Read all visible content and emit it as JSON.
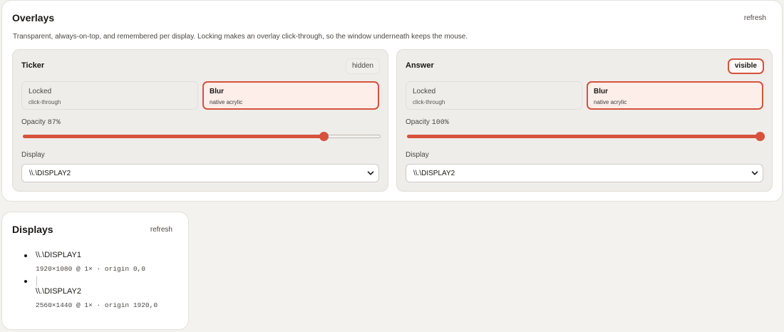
{
  "overlays": {
    "title": "Overlays",
    "refresh_label": "refresh",
    "description": "Transparent, always-on-top, and remembered per display. Locking makes an overlay click-through, so the window underneath keeps the mouse.",
    "panels": [
      {
        "name": "Ticker",
        "status": "hidden",
        "locked_label": "Locked",
        "locked_sub": "click-through",
        "blur_label": "Blur",
        "blur_sub": "native acrylic",
        "blur_selected": true,
        "opacity_label": "Opacity",
        "opacity_value": "87%",
        "opacity": 0.84,
        "display_label": "Display",
        "display_value": "\\\\.\\DISPLAY2"
      },
      {
        "name": "Answer",
        "status": "visible",
        "locked_label": "Locked",
        "locked_sub": "click-through",
        "blur_label": "Blur",
        "blur_sub": "native acrylic",
        "blur_selected": true,
        "opacity_label": "Opacity",
        "opacity_value": "100%",
        "opacity": 1.0,
        "display_label": "Display",
        "display_value": "\\\\.\\DISPLAY2"
      }
    ]
  },
  "displays": {
    "title": "Displays",
    "refresh_label": "refresh",
    "items": [
      {
        "name": "\\\\.\\DISPLAY1",
        "meta": "1920×1080 @ 1× · origin 0,0"
      },
      {
        "name": "\\\\.\\DISPLAY2",
        "meta": "2560×1440 @ 1× · origin 1920,0"
      }
    ]
  },
  "colors": {
    "accent": "#d6523d",
    "background": "#f4f2ef",
    "card": "#ffffff",
    "panel": "#efede9"
  },
  "icons": {
    "select_chevron": "chevron-down-icon"
  }
}
